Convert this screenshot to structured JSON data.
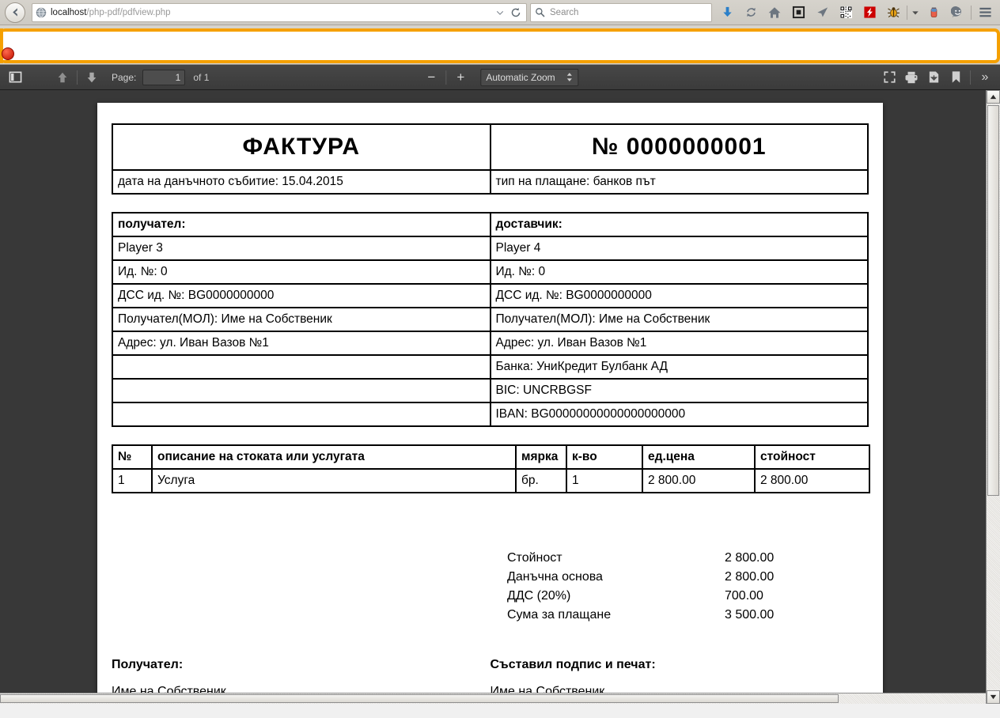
{
  "browser": {
    "back_label": "Back",
    "url_host": "localhost",
    "url_path": "/php-pdf/pdfview.php",
    "search_placeholder": "Search",
    "icons": [
      "download-icon",
      "sync-icon",
      "home-icon",
      "pocket-icon",
      "send-icon",
      "qrcode-icon",
      "flash-icon",
      "firebug-icon",
      "firebug-dropdown-icon",
      "battery-icon",
      "smiley-icon",
      "hamburger-menu-icon"
    ],
    "colors": {
      "notification_border": "#f5a000",
      "download_arrow": "#2a7fc9",
      "flash_red": "#cc0000",
      "toolbar_dark": "#3f3f3f"
    }
  },
  "pdf_toolbar": {
    "sidebar_toggle": "Toggle Sidebar",
    "prev_page": "Previous Page",
    "next_page": "Next Page",
    "page_label": "Page:",
    "page_value": "1",
    "page_of": "of 1",
    "zoom_out": "−",
    "zoom_in": "+",
    "zoom_value": "Automatic Zoom",
    "presentation": "Presentation Mode",
    "print": "Print",
    "download": "Download",
    "bookmark": "Current View",
    "more": "»"
  },
  "invoice": {
    "title": "ФАКТУРА",
    "number": "№ 0000000001",
    "event_date": "дата на данъчното събитие: 15.04.2015",
    "payment_type": "тип на плащане: банков път",
    "recipient": {
      "heading": "получател:",
      "name": "Player 3",
      "id": "Ид. №: 0",
      "vat_id": "ДСС ид. №: BG0000000000",
      "mol": "Получател(МОЛ): Име на Собственик",
      "address": "Адрес: ул. Иван Вазов №1",
      "bank": "",
      "bic": "",
      "iban": ""
    },
    "supplier": {
      "heading": "доставчик:",
      "name": "Player 4",
      "id": "Ид. №: 0",
      "vat_id": "ДСС ид. №: BG0000000000",
      "mol": "Получател(МОЛ): Име на Собственик",
      "address": "Адрес: ул. Иван Вазов №1",
      "bank": "Банка: УниКредит Булбанк АД",
      "bic": "BIC: UNCRBGSF",
      "iban": "IBAN: BG00000000000000000000"
    },
    "items_header": {
      "no": "№",
      "description": "описание на стоката или услугата",
      "unit": "мярка",
      "qty": "к-во",
      "price": "ед.цена",
      "amount": "стойност"
    },
    "items": [
      {
        "no": "1",
        "description": "Услуга",
        "unit": "бр.",
        "qty": "1",
        "price": "2 800.00",
        "amount": "2 800.00"
      }
    ],
    "totals": [
      {
        "label": "Стойност",
        "value": "2 800.00"
      },
      {
        "label": "Данъчна основа",
        "value": "2 800.00"
      },
      {
        "label": "ДДС (20%)",
        "value": "700.00"
      },
      {
        "label": "Сума за плащане",
        "value": "3 500.00"
      }
    ],
    "signatures": {
      "left_title": "Получател:",
      "left_name": "Име на Собственик",
      "right_title": "Съставил подпис и печат:",
      "right_name": "Име на Собственик"
    }
  }
}
